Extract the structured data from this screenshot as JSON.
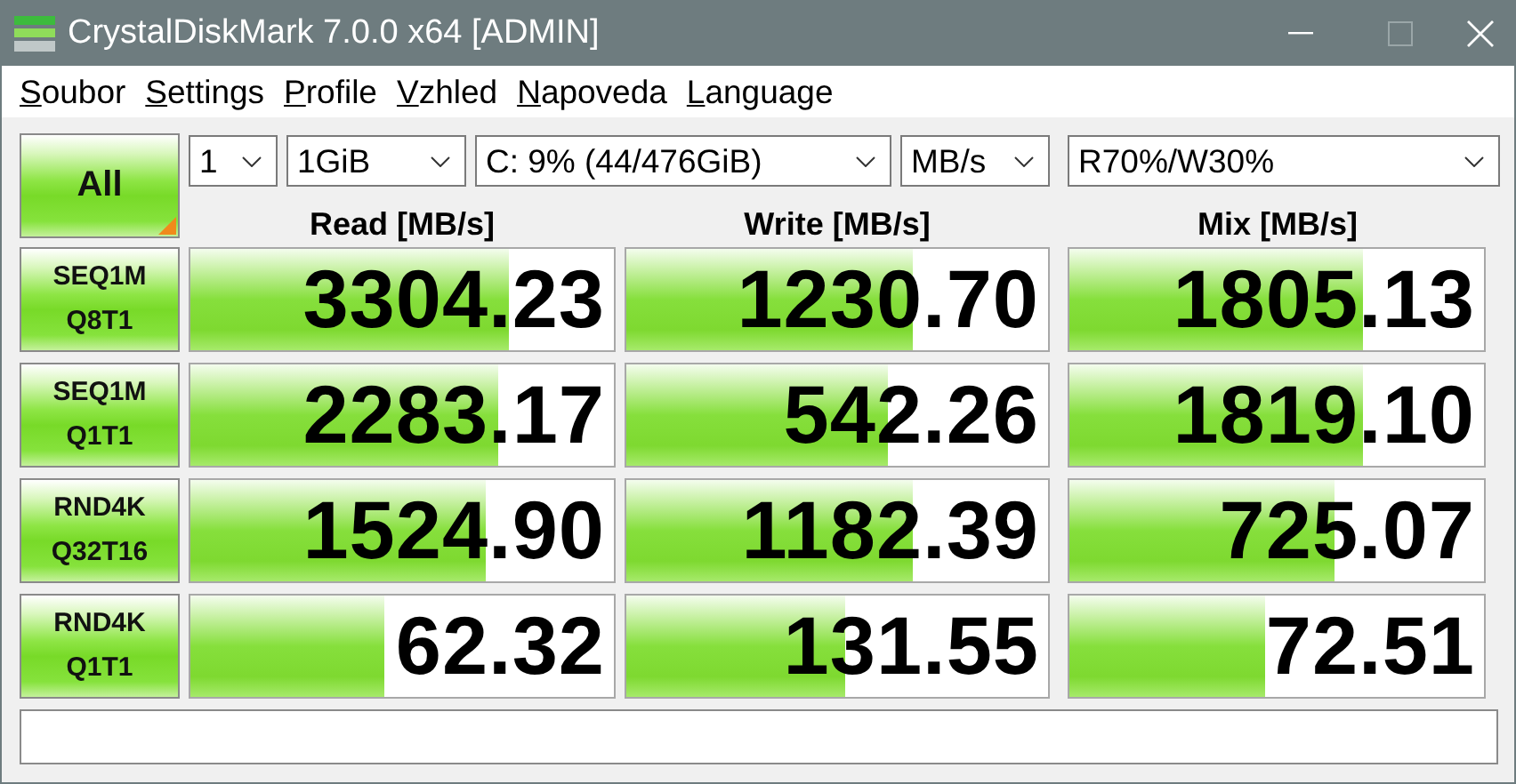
{
  "window": {
    "title": "CrystalDiskMark 7.0.0 x64 [ADMIN]"
  },
  "menu": [
    "Soubor",
    "Settings",
    "Profile",
    "Vzhled",
    "Napoveda",
    "Language"
  ],
  "all_button": "All",
  "selectors": [
    {
      "value": "1"
    },
    {
      "value": "1GiB"
    },
    {
      "value": "C: 9% (44/476GiB)"
    },
    {
      "value": "MB/s"
    },
    {
      "value": "R70%/W30%"
    }
  ],
  "columns": [
    "Read [MB/s]",
    "Write [MB/s]",
    "Mix [MB/s]"
  ],
  "rows": [
    {
      "test": "SEQ1M",
      "params": "Q8T1",
      "results": [
        {
          "value": "3304.23",
          "level": 0.75
        },
        {
          "value": "1230.70",
          "level": 0.68
        },
        {
          "value": "1805.13",
          "level": 0.71
        }
      ]
    },
    {
      "test": "SEQ1M",
      "params": "Q1T1",
      "results": [
        {
          "value": "2283.17",
          "level": 0.725
        },
        {
          "value": "542.26",
          "level": 0.62
        },
        {
          "value": "1819.10",
          "level": 0.71
        }
      ]
    },
    {
      "test": "RND4K",
      "params": "Q32T16",
      "results": [
        {
          "value": "1524.90",
          "level": 0.696
        },
        {
          "value": "1182.39",
          "level": 0.68
        },
        {
          "value": "725.07",
          "level": 0.64
        }
      ]
    },
    {
      "test": "RND4K",
      "params": "Q1T1",
      "results": [
        {
          "value": "62.32",
          "level": 0.46
        },
        {
          "value": "131.55",
          "level": 0.52
        },
        {
          "value": "72.51",
          "level": 0.47
        }
      ]
    }
  ]
}
